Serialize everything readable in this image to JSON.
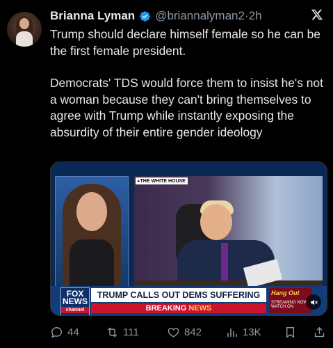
{
  "author": {
    "name": "Brianna Lyman",
    "handle": "@briannalyman2",
    "separator": "·",
    "time": "2h"
  },
  "tweet": {
    "para1": "Trump should declare himself female so he can be the first female president.",
    "para2": "Democrats' TDS would force them to insist he's not a woman because they can't bring themselves to agree with Trump while instantly exposing the absurdity of their entire gender ideology"
  },
  "media": {
    "location_tag": "▸THE WHITE HOUSE",
    "network_top": "FOX",
    "network_bottom": "NEWS",
    "network_channel": "channel",
    "headline": "TRUMP CALLS OUT DEMS SUFFERING FROM \"TDS\"",
    "breaking_1": "BREAKING ",
    "breaking_2": "NEWS",
    "promo_title": "Hang Out",
    "promo_sub": "STREAMING NOW",
    "promo_sub2": "WATCH ON"
  },
  "actions": {
    "replies": "44",
    "reposts": "111",
    "likes": "842",
    "views": "13K"
  },
  "icons": [
    "verified-icon",
    "x-logo-icon",
    "reply-icon",
    "repost-icon",
    "like-icon",
    "views-icon",
    "bookmark-icon",
    "share-icon",
    "mute-icon"
  ],
  "colors": {
    "background": "#000000",
    "verified": "#1d9bf0",
    "text": "#e7e9ea",
    "muted": "#8b98a5"
  }
}
